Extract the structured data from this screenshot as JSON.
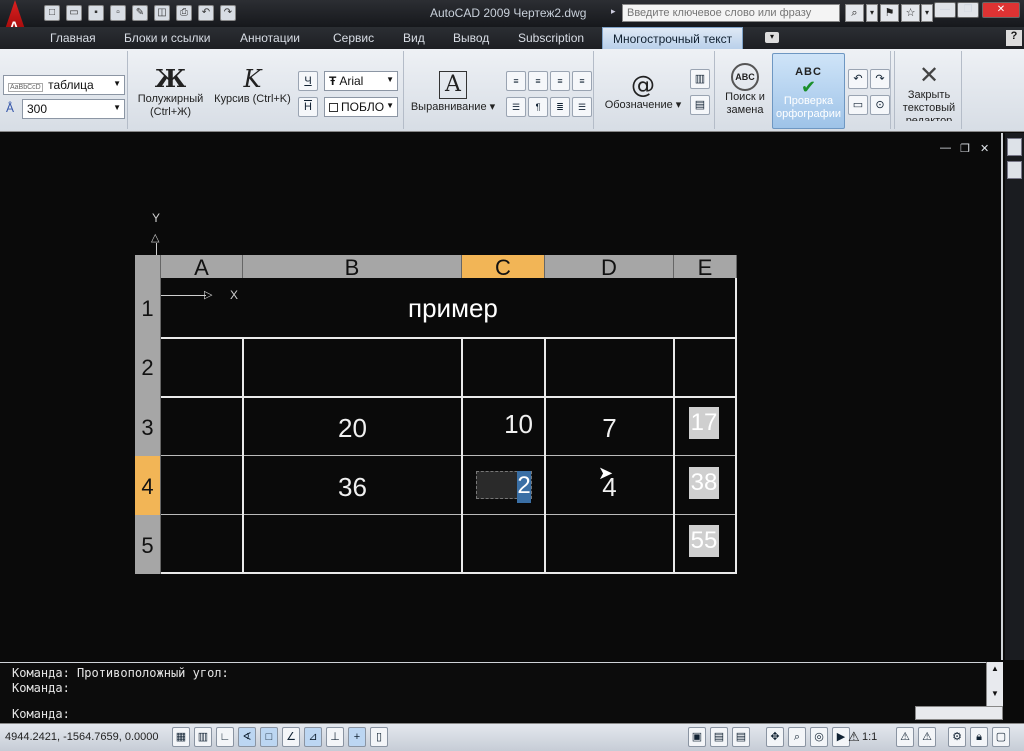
{
  "title_bar": {
    "app_logo": "A",
    "window_title": "AutoCAD 2009 Чертеж2.dwg",
    "search_placeholder": "Введите ключевое слово или фразу",
    "quick_access_icons": [
      "new-icon",
      "open-icon",
      "save-icon",
      "save-as-icon",
      "edit-icon",
      "publish-icon",
      "print-icon",
      "undo-icon",
      "redo-icon"
    ]
  },
  "ribbon_tabs": [
    {
      "label": "Главная"
    },
    {
      "label": "Блоки и ссылки"
    },
    {
      "label": "Аннотации"
    },
    {
      "label": "Сервис"
    },
    {
      "label": "Вид"
    },
    {
      "label": "Вывод"
    },
    {
      "label": "Subscription"
    },
    {
      "label": "Многострочный текст",
      "active": true
    }
  ],
  "ribbon": {
    "style_dropdown": "таблица",
    "style_preview": "AaBbCcD",
    "height_dropdown": "300",
    "bold_label": "Полужирный",
    "bold_shortcut": "(Ctrl+Ж)",
    "italic_label": "Курсив (Ctrl+K)",
    "bold_glyph": "Ж",
    "italic_glyph": "K",
    "underline_glyph": "Ч",
    "overline_glyph": "Н",
    "font_dropdown": "Arial",
    "color_dropdown": "ПОБЛО",
    "align_glyph": "A",
    "align_label": "Выравнивание",
    "symbol_glyph": "@",
    "symbol_label": "Обозначение",
    "find_label_1": "Поиск и",
    "find_label_2": "замена",
    "find_glyph": "ABC",
    "spell_glyph": "ABC",
    "spell_label_1": "Проверка",
    "spell_label_2": "орфографии",
    "close_label_1": "Закрыть",
    "close_label_2": "текстовый",
    "close_label_3": "редактор"
  },
  "table": {
    "column_headers": [
      "A",
      "B",
      "C",
      "D",
      "E"
    ],
    "selected_column": "C",
    "row_headers": [
      "1",
      "2",
      "3",
      "4",
      "5"
    ],
    "selected_row": "4",
    "title": "пример",
    "row3": {
      "B": "20",
      "C": "10",
      "D": "7",
      "E": "17"
    },
    "row4": {
      "B": "36",
      "C": "2",
      "D": "4",
      "E": "38"
    },
    "row5": {
      "E": "55"
    }
  },
  "ucs": {
    "y_label": "Y",
    "x_label": "X"
  },
  "command_line": {
    "line1": "Команда: Противоположный угол:",
    "line2": "Команда:",
    "line3": "Команда:"
  },
  "status_bar": {
    "coordinates": "4944.2421, -1564.7659, 0.0000",
    "annotation_scale": "1:1"
  }
}
